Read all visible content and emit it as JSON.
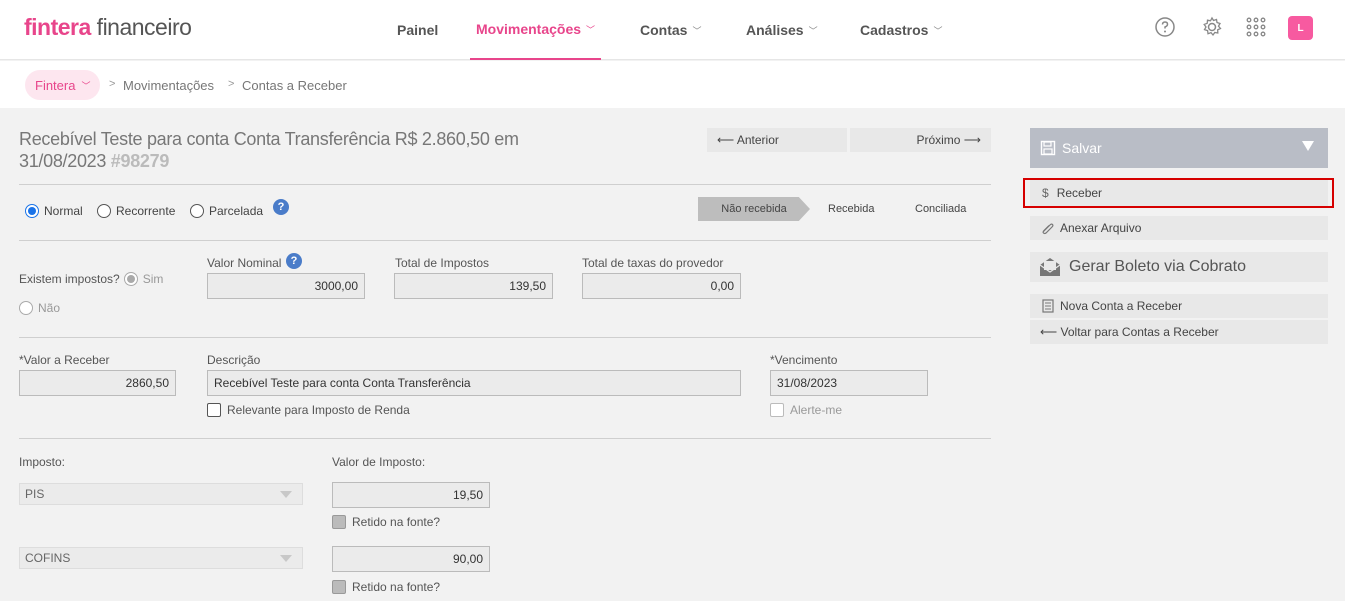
{
  "brand": {
    "bold": "fintera",
    "rest": " financeiro",
    "accent": "#e8458b"
  },
  "nav": [
    {
      "label": "Painel",
      "active": false
    },
    {
      "label": "Movimentações",
      "active": true
    },
    {
      "label": "Contas",
      "active": false
    },
    {
      "label": "Análises",
      "active": false
    },
    {
      "label": "Cadastros",
      "active": false
    }
  ],
  "user": {
    "initial": "L"
  },
  "breadcrumb": {
    "root": "Fintera",
    "items": [
      "Movimentações",
      "Contas a Receber"
    ]
  },
  "record": {
    "title": "Recebível Teste para conta Conta Transferência R$ 2.860,50 em 31/08/2023",
    "id": "#98279",
    "prev_label": "⟵ Anterior",
    "next_label": "Próximo ⟶"
  },
  "type_options": {
    "normal": "Normal",
    "recorrente": "Recorrente",
    "parcelada": "Parcelada",
    "selected": "Normal"
  },
  "status_steps": {
    "nao_recebida": "Não recebida",
    "recebida": "Recebida",
    "conciliada": "Conciliada",
    "current": "Não recebida"
  },
  "impostos": {
    "question": "Existem impostos?",
    "sim": "Sim",
    "nao": "Não",
    "selected": "Sim"
  },
  "fields": {
    "valor_nominal_label": "Valor Nominal",
    "valor_nominal": "3000,00",
    "total_impostos_label": "Total de Impostos",
    "total_impostos": "139,50",
    "total_taxas_label": "Total de taxas do provedor",
    "total_taxas": "0,00",
    "valor_receber_label": "*Valor a Receber",
    "valor_receber": "2860,50",
    "descricao_label": "Descrição",
    "descricao": "Recebível Teste para conta Conta Transferência",
    "vencimento_label": "*Vencimento",
    "vencimento": "31/08/2023",
    "relevante_label": "Relevante para Imposto de Renda",
    "alerte_label": "Alerte-me"
  },
  "taxes": {
    "imposto_label": "Imposto:",
    "valor_label": "Valor de Imposto:",
    "retido_label": "Retido na fonte?",
    "rows": [
      {
        "name": "PIS",
        "value": "19,50"
      },
      {
        "name": "COFINS",
        "value": "90,00"
      }
    ]
  },
  "sidebar": {
    "save": "Salvar",
    "receber": "Receber",
    "anexar": "Anexar Arquivo",
    "boleto": "Gerar Boleto via Cobrato",
    "nova": "Nova Conta a Receber",
    "voltar": "⟵ Voltar para Contas a Receber"
  }
}
